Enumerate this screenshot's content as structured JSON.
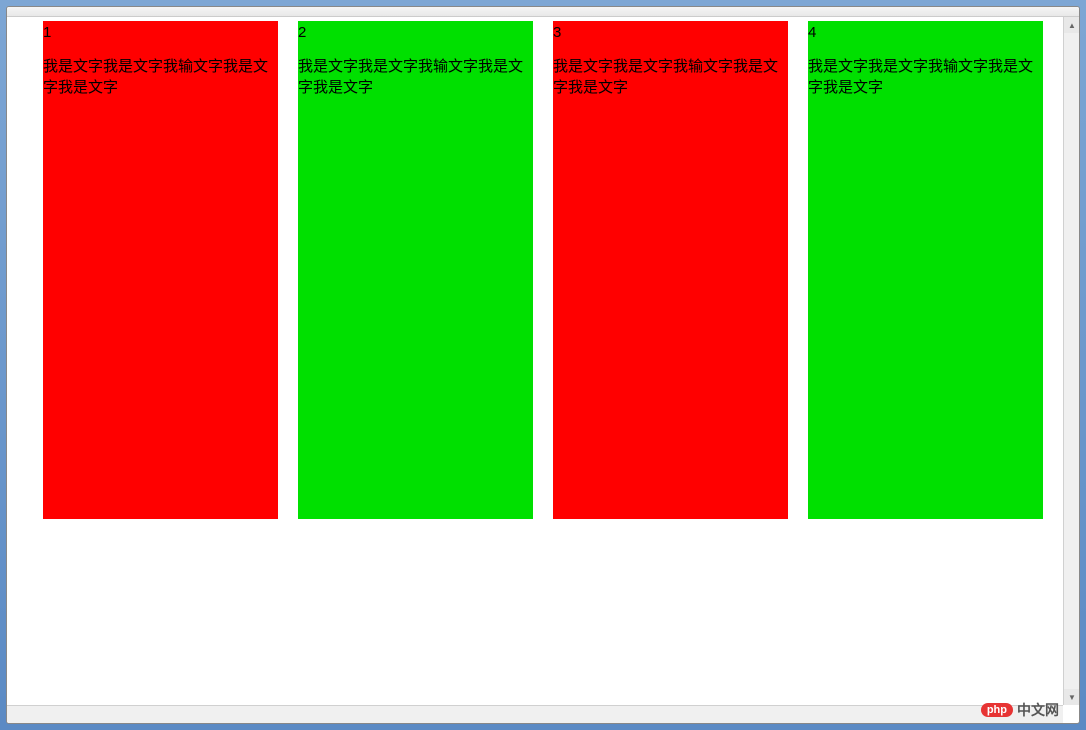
{
  "boxes": [
    {
      "number": "1",
      "text": "我是文字我是文字我输文字我是文字我是文字",
      "color": "red"
    },
    {
      "number": "2",
      "text": "我是文字我是文字我输文字我是文字我是文字",
      "color": "green"
    },
    {
      "number": "3",
      "text": "我是文字我是文字我输文字我是文字我是文字",
      "color": "red"
    },
    {
      "number": "4",
      "text": "我是文字我是文字我输文字我是文字我是文字",
      "color": "green"
    }
  ],
  "watermark": {
    "badge": "php",
    "text": "中文网"
  }
}
